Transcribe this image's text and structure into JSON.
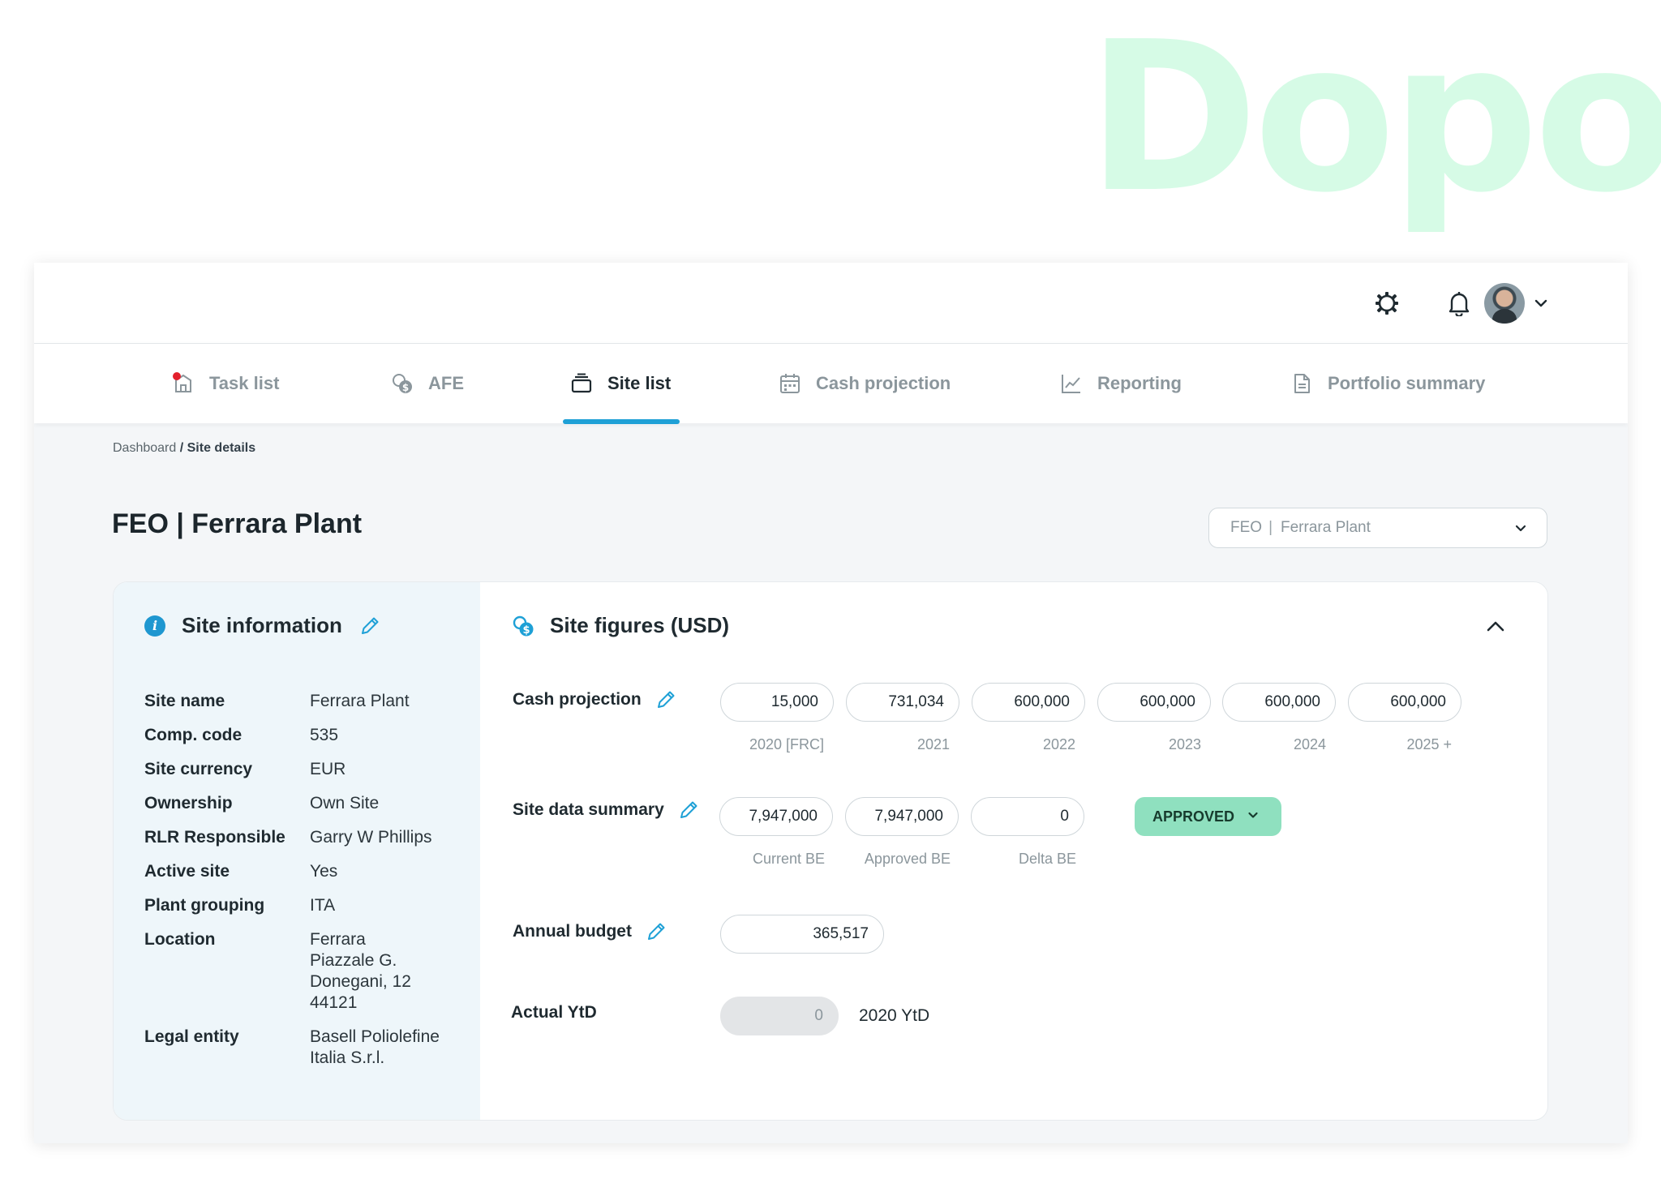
{
  "hero_word": "Dopo",
  "header": {
    "settings_icon": "gear-icon",
    "notifications_icon": "bell-icon",
    "avatar_icon": "user-avatar",
    "avatar_menu_icon": "chevron-down-icon"
  },
  "tabs": [
    {
      "label": "Task list",
      "icon": "task-list-icon",
      "active": false,
      "has_notification": true
    },
    {
      "label": "AFE",
      "icon": "coins-icon",
      "active": false
    },
    {
      "label": "Site list",
      "icon": "stack-icon",
      "active": true
    },
    {
      "label": "Cash projection",
      "icon": "calendar-icon",
      "active": false
    },
    {
      "label": "Reporting",
      "icon": "trend-chart-icon",
      "active": false
    },
    {
      "label": "Portfolio summary",
      "icon": "document-icon",
      "active": false
    }
  ],
  "breadcrumb": {
    "parent": "Dashboard",
    "separator": " / ",
    "current": "Site details"
  },
  "page_title": "FEO | Ferrara Plant",
  "site_selector": {
    "code": "FEO",
    "separator": "|",
    "name": "Ferrara Plant"
  },
  "site_information": {
    "title": "Site information",
    "rows": [
      {
        "key": "Site name",
        "value": "Ferrara Plant"
      },
      {
        "key": "Comp. code",
        "value": "535"
      },
      {
        "key": "Site currency",
        "value": "EUR"
      },
      {
        "key": "Ownership",
        "value": "Own Site"
      },
      {
        "key": "RLR Responsible",
        "value": "Garry W Phillips"
      },
      {
        "key": "Active site",
        "value": "Yes"
      },
      {
        "key": "Plant grouping",
        "value": "ITA"
      },
      {
        "key": "Location",
        "value": "Ferrara\nPiazzale G.\nDonegani, 12\n44121"
      },
      {
        "key": "Legal entity",
        "value": "Basell Poliolefine\nItalia S.r.l."
      }
    ]
  },
  "site_figures": {
    "title": "Site figures (USD)",
    "cash_projection": {
      "label": "Cash projection",
      "values": [
        "15,000",
        "731,034",
        "600,000",
        "600,000",
        "600,000",
        "600,000"
      ],
      "years": [
        "2020 [FRC]",
        "2021",
        "2022",
        "2023",
        "2024",
        "2025 +"
      ]
    },
    "site_data_summary": {
      "label": "Site data summary",
      "values": [
        "7,947,000",
        "7,947,000",
        "0"
      ],
      "captions": [
        "Current BE",
        "Approved BE",
        "Delta BE"
      ],
      "status": "APPROVED"
    },
    "annual_budget": {
      "label": "Annual budget",
      "value": "365,517"
    },
    "actual_ytd": {
      "label": "Actual YtD",
      "value": "0",
      "caption": "2020 YtD"
    }
  },
  "colors": {
    "accent": "#1ea0d6",
    "approved": "#8fe0bf",
    "hero": "#d6fbe6",
    "panel": "#eef6fa"
  }
}
